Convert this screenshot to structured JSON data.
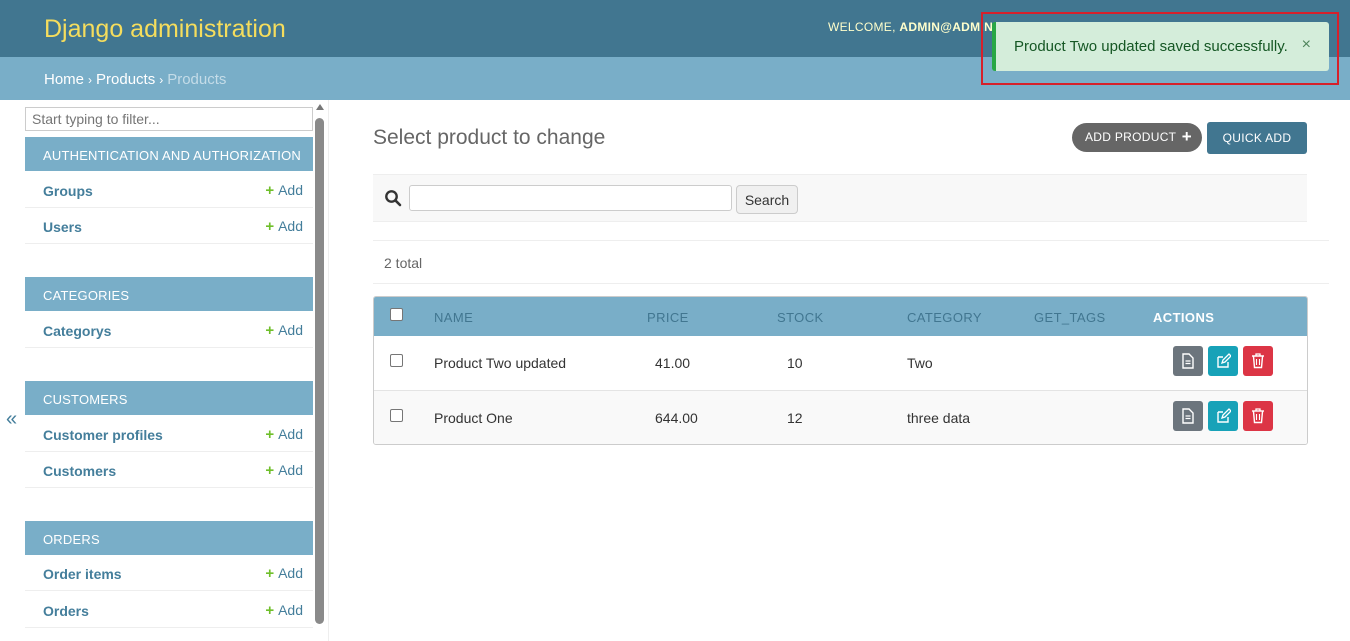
{
  "header": {
    "brand": "Django administration",
    "welcome_label": "WELCOME,",
    "welcome_user": "ADMIN@ADMIN."
  },
  "breadcrumbs": {
    "home": "Home",
    "app": "Products",
    "current": "Products",
    "separator": "›"
  },
  "toast": {
    "message": "Product Two updated saved successfully.",
    "close": "×"
  },
  "sidebar": {
    "filter_placeholder": "Start typing to filter...",
    "collapse": "«",
    "add_label": "Add",
    "modules": [
      {
        "title": "AUTHENTICATION AND AUTHORIZATION",
        "models": [
          "Groups",
          "Users"
        ]
      },
      {
        "title": "CATEGORIES",
        "models": [
          "Categorys"
        ]
      },
      {
        "title": "CUSTOMERS",
        "models": [
          "Customer profiles",
          "Customers"
        ]
      },
      {
        "title": "ORDERS",
        "models": [
          "Order items",
          "Orders"
        ]
      }
    ]
  },
  "main": {
    "title": "Select product to change",
    "add_product": "ADD PRODUCT",
    "quick_add": "QUICK ADD",
    "search_button": "Search",
    "search_value": "",
    "total": "2 total",
    "columns": [
      "NAME",
      "PRICE",
      "STOCK",
      "CATEGORY",
      "GET_TAGS",
      "ACTIONS"
    ],
    "rows": [
      {
        "name": "Product Two updated",
        "price": "41.00",
        "stock": "10",
        "category": "Two",
        "tags": ""
      },
      {
        "name": "Product One",
        "price": "644.00",
        "stock": "12",
        "category": "three data",
        "tags": ""
      }
    ]
  },
  "colors": {
    "header": "#417690",
    "breadcrumbs": "#79aec8",
    "brand": "#f5dd5d",
    "toast_bg": "#d4edda",
    "add_plus": "#70bf2b",
    "view_btn": "#6c757d",
    "edit_btn": "#17a2b8",
    "delete_btn": "#dc3545"
  }
}
